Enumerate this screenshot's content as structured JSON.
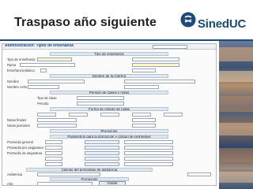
{
  "slide": {
    "title": "Traspaso año siguiente"
  },
  "logo": {
    "brand": "SinedUC"
  },
  "colors": {
    "brand_blue": "#1b4a7d",
    "form_border": "#b7b7b7",
    "field_border": "#9aa7b8"
  },
  "form": {
    "header_label": "Administración: Tipos de enseñanza",
    "sections": [
      "Tipo de enseñanza",
      "Nombre de la Carrera",
      "Periodo de clases y notas",
      "Forma de cálculo de notas",
      "Promoción",
      "Parámetros para la promoción y cálculo de promedios",
      "Cálculo del porcentaje de asistencia",
      "Promoción"
    ],
    "row_labels": [
      "Tipo de enseñanza",
      "Rama",
      "Enseñanza Básica",
      "Nombre",
      "Nombre corto",
      "Tipo de clase",
      "Periodo",
      "Notas finales",
      "Notas parciales",
      "Promedio general",
      "Promedio por asignatura",
      "Promedio de asignatura",
      "Asistencia",
      "Año"
    ],
    "button_label": "Grabar"
  }
}
